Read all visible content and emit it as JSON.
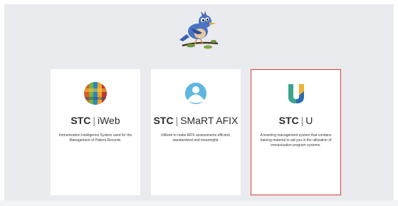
{
  "cards": [
    {
      "brand": "STC",
      "separator": "|",
      "product": "iWeb",
      "description": "Immunization Intelligence System used for the Management of Patient Records.",
      "icon": "iweb-logo-icon"
    },
    {
      "brand": "STC",
      "separator": "|",
      "product": "SMaRT AFIX",
      "description": "Utilized to make AFIX assessments efficient, standardized and meaningful.",
      "icon": "smart-afix-logo-icon"
    },
    {
      "brand": "STC",
      "separator": "|",
      "product": "U",
      "description": "A learning management system that contains training material to aid you in the utilization of immunization program systems.",
      "icon": "stc-u-logo-icon",
      "selected": true
    }
  ],
  "colors": {
    "background": "#e9ebef",
    "card": "#ffffff",
    "selected_border": "#d9402f"
  }
}
